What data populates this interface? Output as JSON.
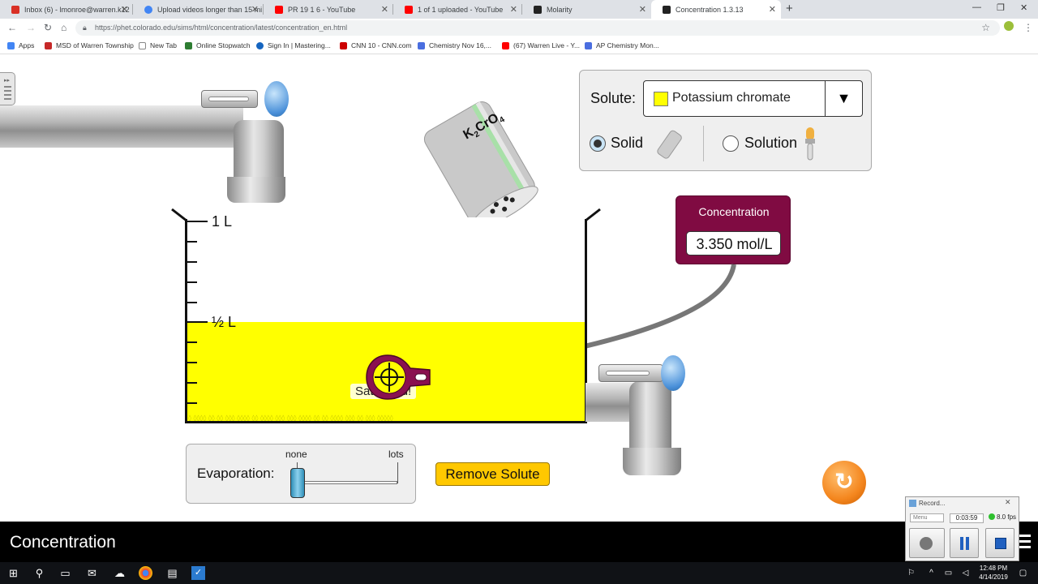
{
  "browser": {
    "tabs": [
      {
        "label": "Inbox (6) - lmonroe@warren.k12",
        "favicon_color": "#d93025"
      },
      {
        "label": "Upload videos longer than 15 mi",
        "favicon_color": "#4285f4"
      },
      {
        "label": "PR 19 1 6 - YouTube",
        "favicon_color": "#ff0000"
      },
      {
        "label": "1 of 1 uploaded - YouTube",
        "favicon_color": "#ff0000"
      },
      {
        "label": "Molarity",
        "favicon_color": "#222222"
      },
      {
        "label": "Concentration 1.3.13",
        "favicon_color": "#222222"
      }
    ],
    "new_tab_glyph": "+",
    "url": "https://phet.colorado.edu/sims/html/concentration/latest/concentration_en.html",
    "bookmarks": [
      {
        "label": "Apps",
        "icon_color": "#4285f4"
      },
      {
        "label": "MSD of Warren Township",
        "icon_color": "#c62828"
      },
      {
        "label": "New Tab",
        "icon_color": "#888888"
      },
      {
        "label": "Online Stopwatch",
        "icon_color": "#2e7d32"
      },
      {
        "label": "Sign In | Mastering...",
        "icon_color": "#1565c0"
      },
      {
        "label": "CNN 10 - CNN.com",
        "icon_color": "#cc0000"
      },
      {
        "label": "Chemistry Nov 16,...",
        "icon_color": "#4a6ee0"
      },
      {
        "label": "(67) Warren Live - Y...",
        "icon_color": "#ff0000"
      },
      {
        "label": "AP Chemistry Mon...",
        "icon_color": "#4a6ee0"
      }
    ]
  },
  "sim": {
    "solute_panel": {
      "label": "Solute:",
      "selected_solute": "Potassium chromate",
      "solute_color": "#ffff00",
      "mode_solid": "Solid",
      "mode_solution": "Solution",
      "selected_mode": "Solid"
    },
    "shaker_label": "K2CrO4",
    "concentration_meter": {
      "title": "Concentration",
      "value": "3.350 mol/L"
    },
    "beaker": {
      "label_full": "1 L",
      "label_half": "½ L",
      "fill_fraction": 0.5,
      "solution_color": "#ffff00"
    },
    "saturated_indicator": "Saturated!",
    "evaporation": {
      "label": "Evaporation:",
      "min_label": "none",
      "max_label": "lots",
      "level": 0
    },
    "remove_solute_label": "Remove Solute",
    "title": "Concentration"
  },
  "recorder": {
    "title": "Record...",
    "menu": "Menu",
    "time": "0:03:59",
    "fps": "8.0 fps"
  },
  "taskbar": {
    "time": "12:48 PM",
    "date": "4/14/2019"
  }
}
